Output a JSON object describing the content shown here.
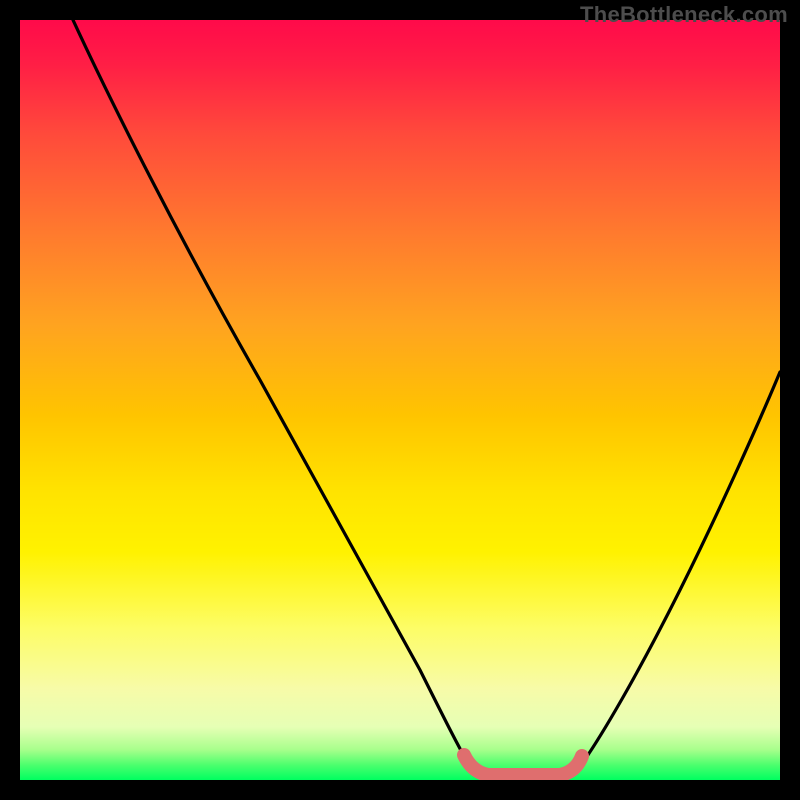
{
  "watermark": "TheBottleneck.com",
  "chart_data": {
    "type": "line",
    "title": "",
    "xlabel": "",
    "ylabel": "",
    "xlim": [
      0,
      100
    ],
    "ylim": [
      0,
      100
    ],
    "series": [
      {
        "name": "left-curve",
        "x": [
          7,
          10,
          15,
          20,
          25,
          30,
          35,
          40,
          45,
          50,
          53,
          56,
          58,
          59,
          60
        ],
        "y": [
          100,
          96,
          89,
          82,
          74,
          66,
          57,
          48,
          38,
          27,
          19,
          11,
          5,
          2,
          0
        ],
        "color": "#000000"
      },
      {
        "name": "right-curve",
        "x": [
          73,
          75,
          78,
          82,
          86,
          90,
          94,
          98,
          100
        ],
        "y": [
          0,
          3,
          8,
          16,
          25,
          35,
          45,
          55,
          60
        ],
        "color": "#000000"
      },
      {
        "name": "valley-highlight",
        "x": [
          58,
          60,
          62,
          65,
          68,
          71,
          73,
          74
        ],
        "y": [
          4,
          1,
          0,
          0,
          0,
          0,
          1,
          3
        ],
        "color": "#e06a6a"
      }
    ],
    "gradient_background": {
      "orientation": "vertical",
      "stops": [
        {
          "pos": 0.0,
          "color": "#ff0a4a"
        },
        {
          "pos": 0.3,
          "color": "#ff7a2e"
        },
        {
          "pos": 0.55,
          "color": "#ffc400"
        },
        {
          "pos": 0.75,
          "color": "#fdfd66"
        },
        {
          "pos": 0.93,
          "color": "#e6ffb5"
        },
        {
          "pos": 1.0,
          "color": "#00ff60"
        }
      ]
    }
  }
}
